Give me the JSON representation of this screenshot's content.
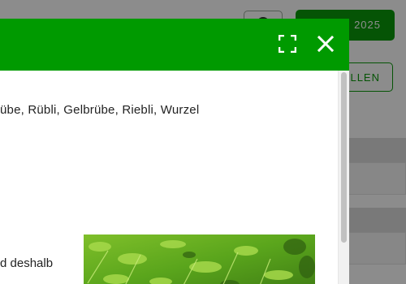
{
  "background": {
    "year_button_label": "2025",
    "outline_button_label": "LLEN"
  },
  "modal": {
    "header_color": "#009a00",
    "icons": {
      "fullscreen": "fullscreen-icon",
      "close": "close-icon"
    },
    "synonyms_text": "übe, Rübli, Gelbrübe, Riebli, Wurzel",
    "body_text": "d deshalb"
  }
}
